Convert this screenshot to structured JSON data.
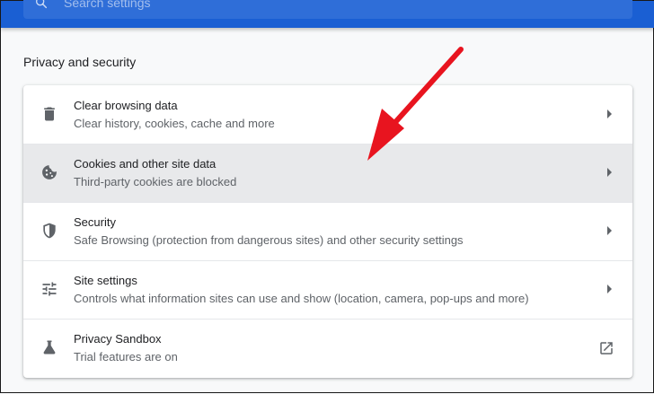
{
  "search": {
    "placeholder": "Search settings"
  },
  "section": {
    "title": "Privacy and security"
  },
  "items": [
    {
      "title": "Clear browsing data",
      "subtitle": "Clear history, cookies, cache and more",
      "icon": "trash-icon",
      "action": "chevron-right-icon"
    },
    {
      "title": "Cookies and other site data",
      "subtitle": "Third-party cookies are blocked",
      "icon": "cookie-icon",
      "action": "chevron-right-icon",
      "highlighted": true
    },
    {
      "title": "Security",
      "subtitle": "Safe Browsing (protection from dangerous sites) and other security settings",
      "icon": "shield-icon",
      "action": "chevron-right-icon"
    },
    {
      "title": "Site settings",
      "subtitle": "Controls what information sites can use and show (location, camera, pop-ups and more)",
      "icon": "tune-icon",
      "action": "chevron-right-icon"
    },
    {
      "title": "Privacy Sandbox",
      "subtitle": "Trial features are on",
      "icon": "flask-icon",
      "action": "open-in-new-icon"
    }
  ],
  "colors": {
    "header": "#1a5fd3",
    "highlight_row": "#e8e9eb",
    "annotation_arrow": "#e8141f"
  }
}
